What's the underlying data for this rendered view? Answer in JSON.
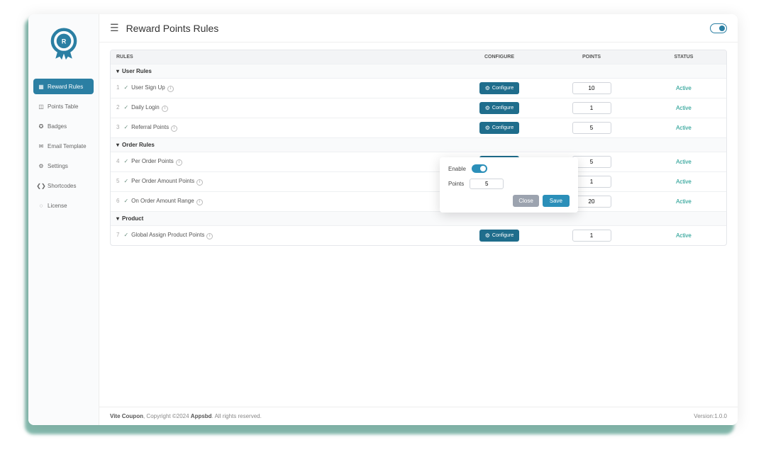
{
  "page_title": "Reward Points Rules",
  "sidebar": {
    "items": [
      {
        "label": "Reward Rules",
        "icon": "rules"
      },
      {
        "label": "Points Table",
        "icon": "table"
      },
      {
        "label": "Badges",
        "icon": "badge"
      },
      {
        "label": "Email Template",
        "icon": "mail"
      },
      {
        "label": "Settings",
        "icon": "gear"
      },
      {
        "label": "Shortcodes",
        "icon": "code"
      },
      {
        "label": "License",
        "icon": "license"
      }
    ]
  },
  "columns": {
    "rules": "Rules",
    "configure": "Configure",
    "points": "Points",
    "status": "Status"
  },
  "groups": [
    {
      "title": "User Rules",
      "rows": [
        {
          "num": "1",
          "name": "User Sign Up",
          "points": "10",
          "status": "Active"
        },
        {
          "num": "2",
          "name": "Daily Login",
          "points": "1",
          "status": "Active"
        },
        {
          "num": "3",
          "name": "Referral Points",
          "points": "5",
          "status": "Active"
        }
      ]
    },
    {
      "title": "Order Rules",
      "rows": [
        {
          "num": "4",
          "name": "Per Order Points",
          "points": "5",
          "status": "Active"
        },
        {
          "num": "5",
          "name": "Per Order Amount Points",
          "points": "1",
          "status": "Active"
        },
        {
          "num": "6",
          "name": "On Order Amount Range",
          "points": "20",
          "status": "Active"
        }
      ]
    },
    {
      "title": "Product",
      "rows": [
        {
          "num": "7",
          "name": "Global Assign Product Points",
          "points": "1",
          "status": "Active"
        }
      ]
    }
  ],
  "configure_label": "Configure",
  "popover": {
    "enable_label": "Enable",
    "points_label": "Points",
    "points_value": "5",
    "close_label": "Close",
    "save_label": "Save"
  },
  "footer": {
    "product": "Vite Coupon",
    "copyright": ", Copyright ©2024 ",
    "author": "Appsbd",
    "rights": ". All rights reserved.",
    "version_label": "Version:",
    "version": "1.0.0"
  }
}
